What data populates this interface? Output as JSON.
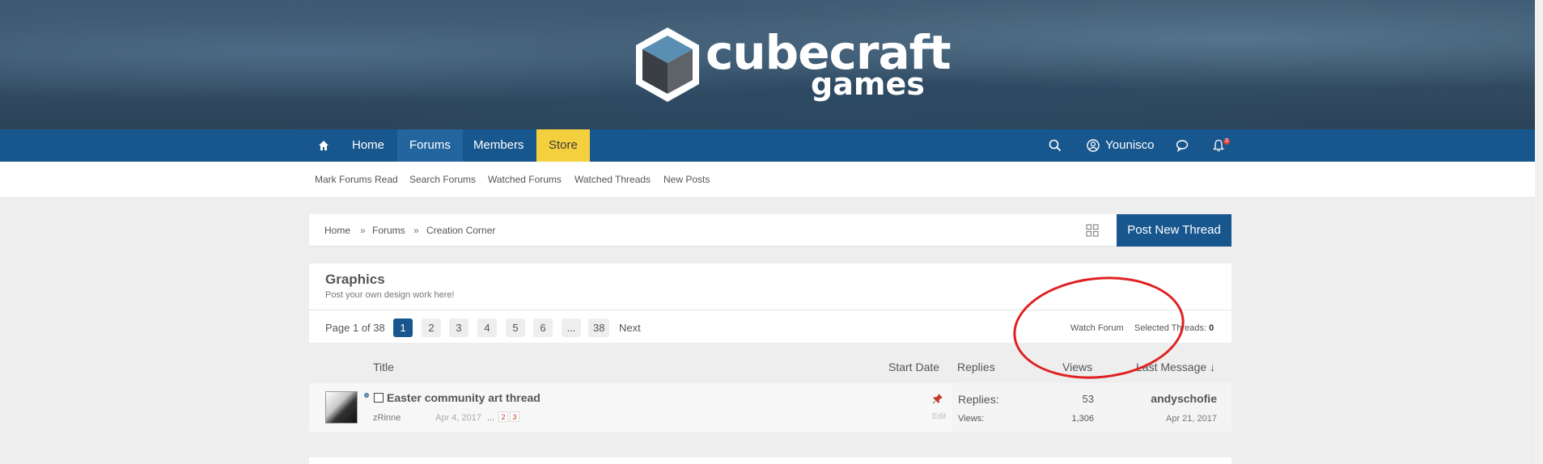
{
  "logo": {
    "word1": "cubecraft",
    "word2": "games"
  },
  "nav": {
    "home": "Home",
    "forums": "Forums",
    "members": "Members",
    "store": "Store",
    "username": "Younisco",
    "notification_count": "3"
  },
  "subnav": {
    "items": [
      "Mark Forums Read",
      "Search Forums",
      "Watched Forums",
      "Watched Threads",
      "New Posts"
    ]
  },
  "breadcrumb": {
    "items": [
      "Home",
      "Forums",
      "Creation Corner"
    ],
    "separator": "»"
  },
  "post_button": "Post New Thread",
  "forum": {
    "title": "Graphics",
    "description": "Post your own design work here!",
    "page_label": "Page 1 of 38",
    "pages": [
      "1",
      "2",
      "3",
      "4",
      "5",
      "6",
      "...",
      "38"
    ],
    "next": "Next",
    "watch_forum": "Watch Forum",
    "selected_threads_label": "Selected Threads:",
    "selected_threads_count": "0"
  },
  "columns": {
    "title": "Title",
    "start_date": "Start Date",
    "replies": "Replies",
    "views": "Views",
    "last_message": "Last Message ↓"
  },
  "threads": [
    {
      "title": "Easter community art thread",
      "author": "zRinne",
      "date": "Apr 4, 2017",
      "ellipsis": "...",
      "mini_pages": [
        "2",
        "3"
      ],
      "edit": "Edit",
      "replies_label": "Replies:",
      "replies": "53",
      "views_label": "Views:",
      "views": "1,306",
      "last_user": "andyschofie",
      "last_date": "Apr 21, 2017"
    }
  ],
  "icons": {
    "home": "home-icon",
    "search": "search-icon",
    "user": "user-icon",
    "chat": "chat-icon",
    "bell": "bell-icon",
    "grid": "grid-icon",
    "pin": "pin-icon"
  },
  "colors": {
    "nav_bg": "#18578e",
    "store_bg": "#f4d03f",
    "annotation": "#e02020"
  }
}
